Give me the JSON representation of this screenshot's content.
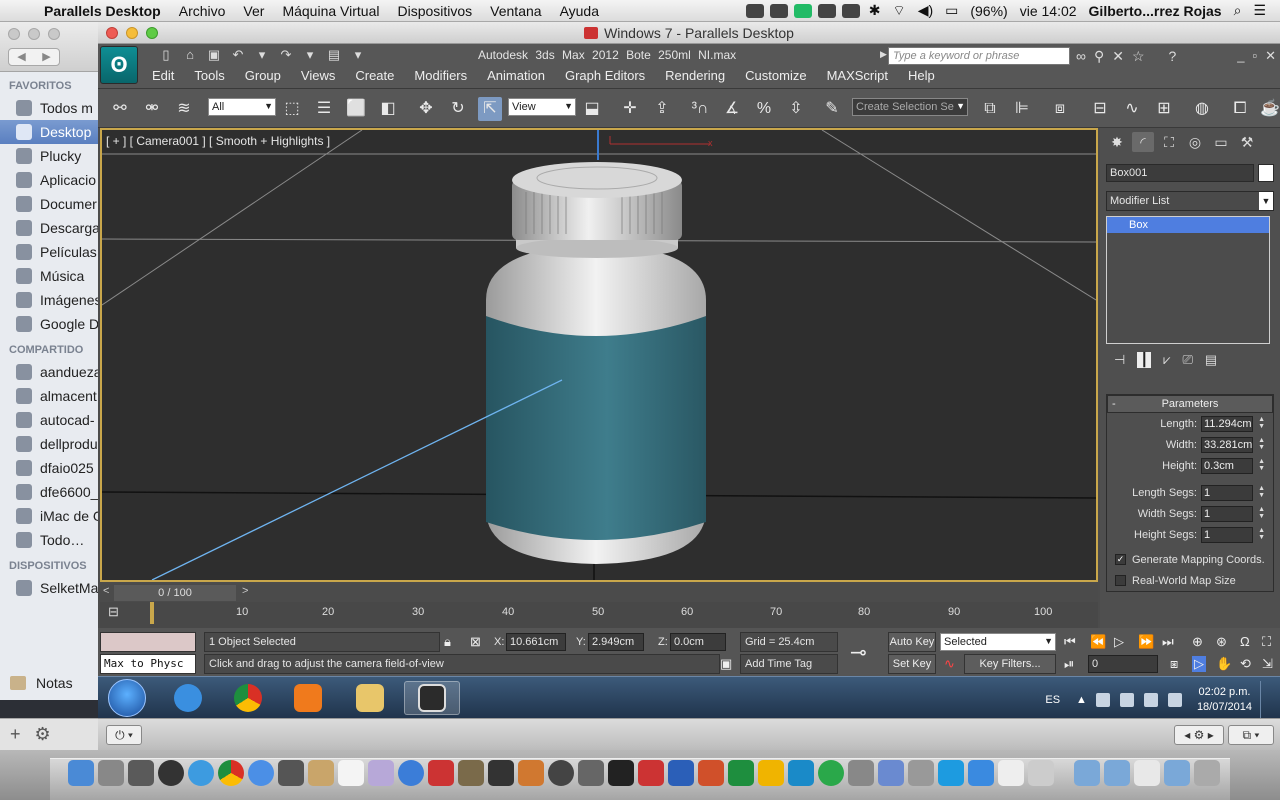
{
  "mac_menubar": {
    "app": "Parallels Desktop",
    "menus": [
      "Archivo",
      "Ver",
      "Máquina Virtual",
      "Dispositivos",
      "Ventana",
      "Ayuda"
    ],
    "battery": "(96%)",
    "clock": "vie 14:02",
    "user": "Gilberto...rrez Rojas"
  },
  "finder": {
    "sections": [
      {
        "title": "FAVORITOS",
        "items": [
          "Todos m",
          "Desktop",
          "Plucky",
          "Aplicacio",
          "Documer",
          "Descarga",
          "Películas",
          "Música",
          "Imágenes",
          "Google D"
        ]
      },
      {
        "title": "COMPARTIDO",
        "items": [
          "aandueza",
          "almacent",
          "autocad-",
          "dellprodu",
          "dfaio025",
          "dfe6600_",
          "iMac de G",
          "Todo…"
        ]
      },
      {
        "title": "DISPOSITIVOS",
        "items": [
          "SelketMa"
        ]
      }
    ],
    "selected": "Desktop",
    "notas": "Notas"
  },
  "parallels": {
    "title": "Windows 7 - Parallels Desktop"
  },
  "max": {
    "title": "Autodesk 3ds Max  2012     Bote 250ml NI.max",
    "search_placeholder": "Type a keyword or phrase",
    "menus": [
      "Edit",
      "Tools",
      "Group",
      "Views",
      "Create",
      "Modifiers",
      "Animation",
      "Graph Editors",
      "Rendering",
      "Customize",
      "MAXScript",
      "Help"
    ],
    "toolbar": {
      "filter": "All",
      "ref_coord": "View",
      "selection_set": "Create Selection Se"
    },
    "viewport_label": "[ + ] [ Camera001 ] [ Smooth + Highlights ]",
    "command_panel": {
      "object_name": "Box001",
      "modifier_list": "Modifier List",
      "stack_item": "Box",
      "rollout": "Parameters",
      "params": [
        {
          "label": "Length:",
          "value": "11.294cm"
        },
        {
          "label": "Width:",
          "value": "33.281cm"
        },
        {
          "label": "Height:",
          "value": "0.3cm"
        },
        {
          "label": "Length Segs:",
          "value": "1"
        },
        {
          "label": "Width Segs:",
          "value": "1"
        },
        {
          "label": "Height Segs:",
          "value": "1"
        }
      ],
      "check1": "Generate Mapping Coords.",
      "check2": "Real-World Map Size"
    },
    "time_slider": "0 / 100",
    "ticks": [
      "0",
      "10",
      "20",
      "30",
      "40",
      "50",
      "60",
      "70",
      "80",
      "90",
      "100"
    ],
    "status": {
      "maxscript": "Max to Physc",
      "selected": "1 Object Selected",
      "prompt": "Click and drag to adjust the camera field-of-view",
      "x": "10.661cm",
      "y": "2.949cm",
      "z": "0.0cm",
      "grid": "Grid = 25.4cm",
      "add_time_tag": "Add Time Tag",
      "auto_key": "Auto Key",
      "set_key": "Set Key",
      "selected_dd": "Selected",
      "key_filters": "Key Filters...",
      "frame": "0"
    }
  },
  "win_taskbar": {
    "lang": "ES",
    "time": "02:02 p.m.",
    "date": "18/07/2014"
  }
}
